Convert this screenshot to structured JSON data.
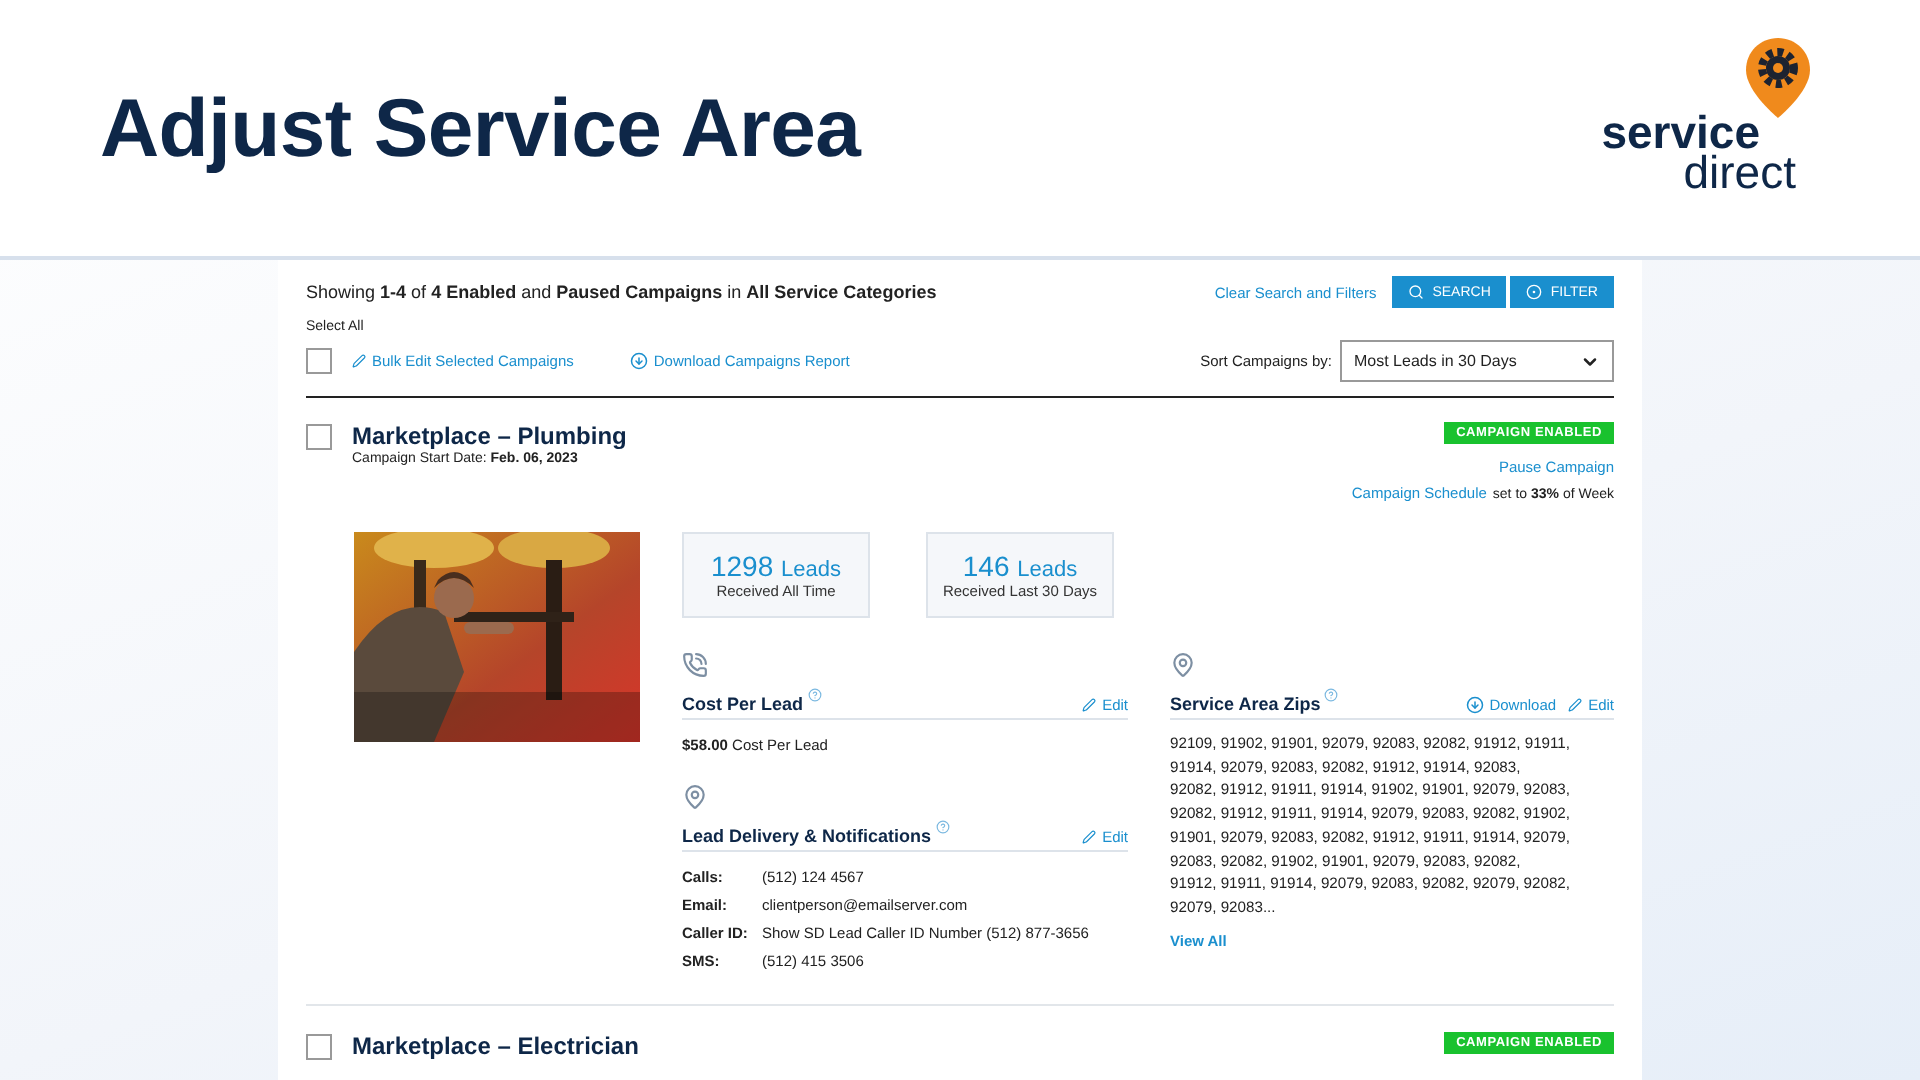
{
  "header": {
    "title": "Adjust Service Area",
    "logo": {
      "line1": "service",
      "line2": "direct"
    }
  },
  "toolbar": {
    "summary": "Showing **1-4** of **4 Enabled** and **Paused Campaigns** in **All Service Categories**",
    "clear_link": "Clear Search and Filters",
    "buttons": [
      {
        "label": "SEARCH",
        "kind": "search"
      },
      {
        "label": "FILTER",
        "kind": "filter"
      }
    ],
    "select_all": {
      "label": "Select All",
      "checked": false
    },
    "actions": [
      {
        "label": "Bulk Edit Selected Campaigns",
        "kind": "edit"
      },
      {
        "label": "Download Campaigns Report",
        "kind": "download"
      }
    ],
    "sort": {
      "label": "Sort Campaigns by:",
      "value": "Most Leads in 30 Days"
    }
  },
  "campaigns": [
    {
      "title": "Marketplace – Plumbing",
      "checked": false,
      "status": "CAMPAIGN ENABLED",
      "enabled": true,
      "start_date": "Campaign Start Date: **Feb. 06, 2023**",
      "pause": "Pause Campaign",
      "schedule_link": "Campaign Schedule",
      "schedule_text": "set to **33%** of Week",
      "stats": [
        {
          "number": "1298",
          "unit": "Leads",
          "caption": "Received All Time"
        },
        {
          "number": "146",
          "unit": "Leads",
          "caption": "Received Last 30 Days"
        }
      ],
      "cost": {
        "title": "Cost Per Lead",
        "edit": "Edit",
        "value": "**$58.00** Cost Per Lead"
      },
      "delivery": {
        "title": "Lead Delivery & Notifications",
        "edit": "Edit",
        "rows": [
          {
            "label": "Calls:",
            "value": "(512) 124 4567"
          },
          {
            "label": "Email:",
            "value": "clientperson@emailserver.com"
          },
          {
            "label": "Caller ID:",
            "value": "Show SD Lead Caller ID Number (512) 877-3656"
          },
          {
            "label": "SMS:",
            "value": "(512) 415 3506"
          }
        ]
      },
      "zips": {
        "title": "Service Area Zips",
        "download": "Download",
        "edit": "Edit",
        "text": "92109, 91902, 91901, 92079, 92083, 92082, 91912, 91911, 91914, 92079, 92083, 92082, 91912, 91914, 92083, 92082, 91912, 91911, 91914, 91902, 91901, 92079, 92083, 92082, 91912, 91911, 91914, 92079, 92083, 92082, 91902, 91901, 92079, 92083, 92082, 91912, 91911, 91914, 92079, 92083, 92082, 91902, 91901, 92079, 92083, 92082, 91912, 91911, 91914, 92079, 92083, 92082, 92079, 92082, 92079, 92083...",
        "view_all": "View All"
      }
    },
    {
      "title": "Marketplace – Electrician",
      "checked": false,
      "status": "CAMPAIGN ENABLED",
      "enabled": true
    }
  ]
}
